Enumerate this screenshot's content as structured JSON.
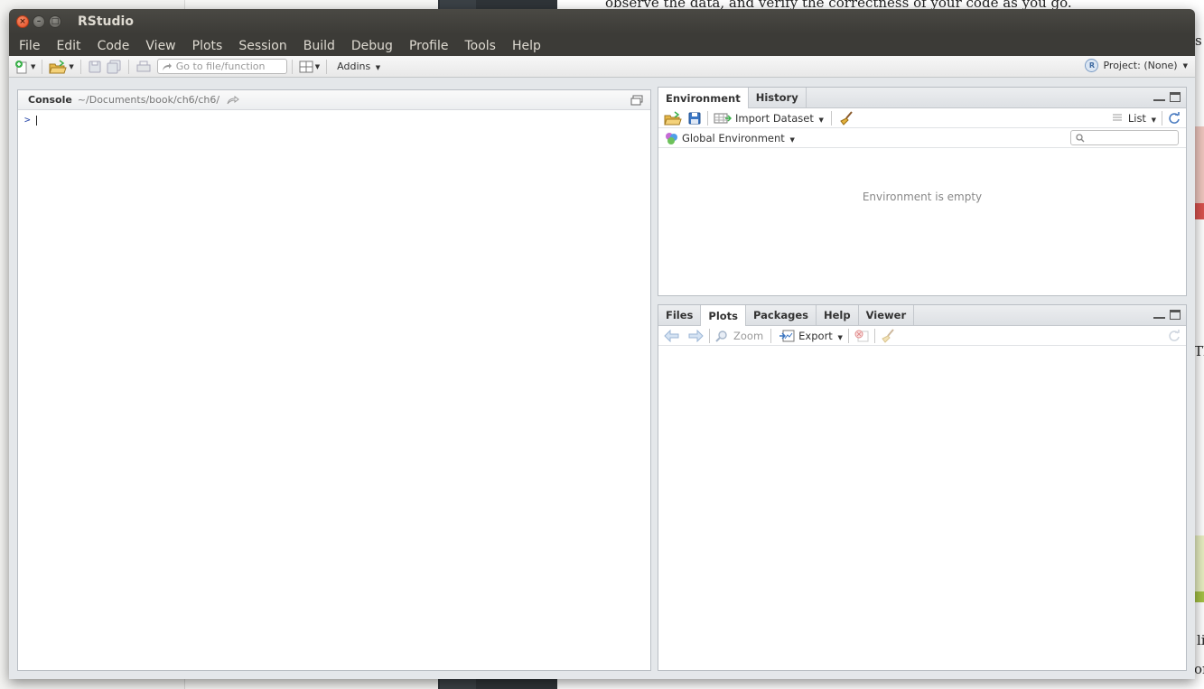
{
  "window": {
    "title": "RStudio"
  },
  "menubar": [
    "File",
    "Edit",
    "Code",
    "View",
    "Plots",
    "Session",
    "Build",
    "Debug",
    "Profile",
    "Tools",
    "Help"
  ],
  "toolbar": {
    "goto_placeholder": "Go to file/function",
    "addins_label": "Addins",
    "project_label": "Project: (None)"
  },
  "console": {
    "label": "Console",
    "path": "~/Documents/book/ch6/ch6/",
    "prompt": ">"
  },
  "env_pane": {
    "tabs": [
      "Environment",
      "History"
    ],
    "active_tab": "Environment",
    "import_label": "Import Dataset",
    "view_label": "List",
    "scope_label": "Global Environment",
    "empty_message": "Environment is empty"
  },
  "viewer_pane": {
    "tabs": [
      "Files",
      "Plots",
      "Packages",
      "Help",
      "Viewer"
    ],
    "active_tab": "Plots",
    "zoom_label": "Zoom",
    "export_label": "Export"
  },
  "background": {
    "line1": "observe the data, and verify the correctness of your code as you go.",
    "line2": "s",
    "line3": "Th",
    "line4": "li",
    "line5": "or"
  },
  "colors": {
    "titlebar": "#3c3b37",
    "close_button": "#e2481f",
    "prompt": "#2b4aaa"
  }
}
